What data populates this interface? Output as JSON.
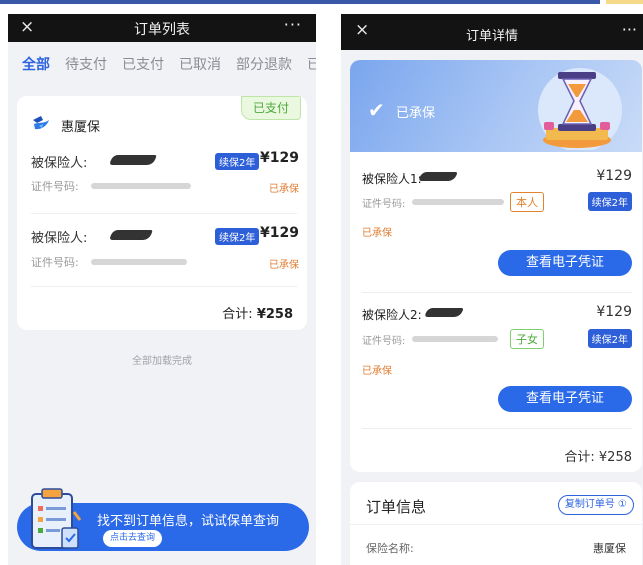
{
  "left": {
    "nav": {
      "close": "×",
      "title": "订单列表",
      "more": "···"
    },
    "tabs": [
      "全部",
      "待支付",
      "已支付",
      "已取消",
      "部分退款",
      "已"
    ],
    "order": {
      "paid_tag": "已支付",
      "brand": "惠厦保",
      "insured": [
        {
          "label": "被保险人:",
          "badge": "续保2年",
          "price": "¥129",
          "id_label": "证件号码:",
          "status": "已承保"
        },
        {
          "label": "被保险人:",
          "badge": "续保2年",
          "price": "¥129",
          "id_label": "证件号码:",
          "status": "已承保"
        }
      ],
      "total_label": "合计:",
      "total_value": "¥258"
    },
    "load_done": "全部加载完成",
    "banner": {
      "text": "找不到订单信息，试试保单查询",
      "button": "点击去查询"
    }
  },
  "right": {
    "nav": {
      "close": "×",
      "title": "订单详情",
      "more": "···"
    },
    "status": "已承保",
    "insured": [
      {
        "label": "被保险人1:",
        "price": "¥129",
        "id_label": "证件号码:",
        "relation": "本人",
        "badge": "续保2年",
        "status": "已承保",
        "button": "查看电子凭证"
      },
      {
        "label": "被保险人2:",
        "price": "¥129",
        "id_label": "证件号码:",
        "relation": "子女",
        "badge": "续保2年",
        "status": "已承保",
        "button": "查看电子凭证"
      }
    ],
    "total": "合计: ¥258",
    "order_info": {
      "title": "订单信息",
      "copy_button": "复制订单号 ①",
      "name_key": "保险名称:",
      "name_value": "惠厦保"
    }
  },
  "colors": {
    "accent": "#2a69e8",
    "paid_green": "#4caa3a",
    "status_orange": "#e07a2e",
    "nav_dark": "#131313"
  }
}
